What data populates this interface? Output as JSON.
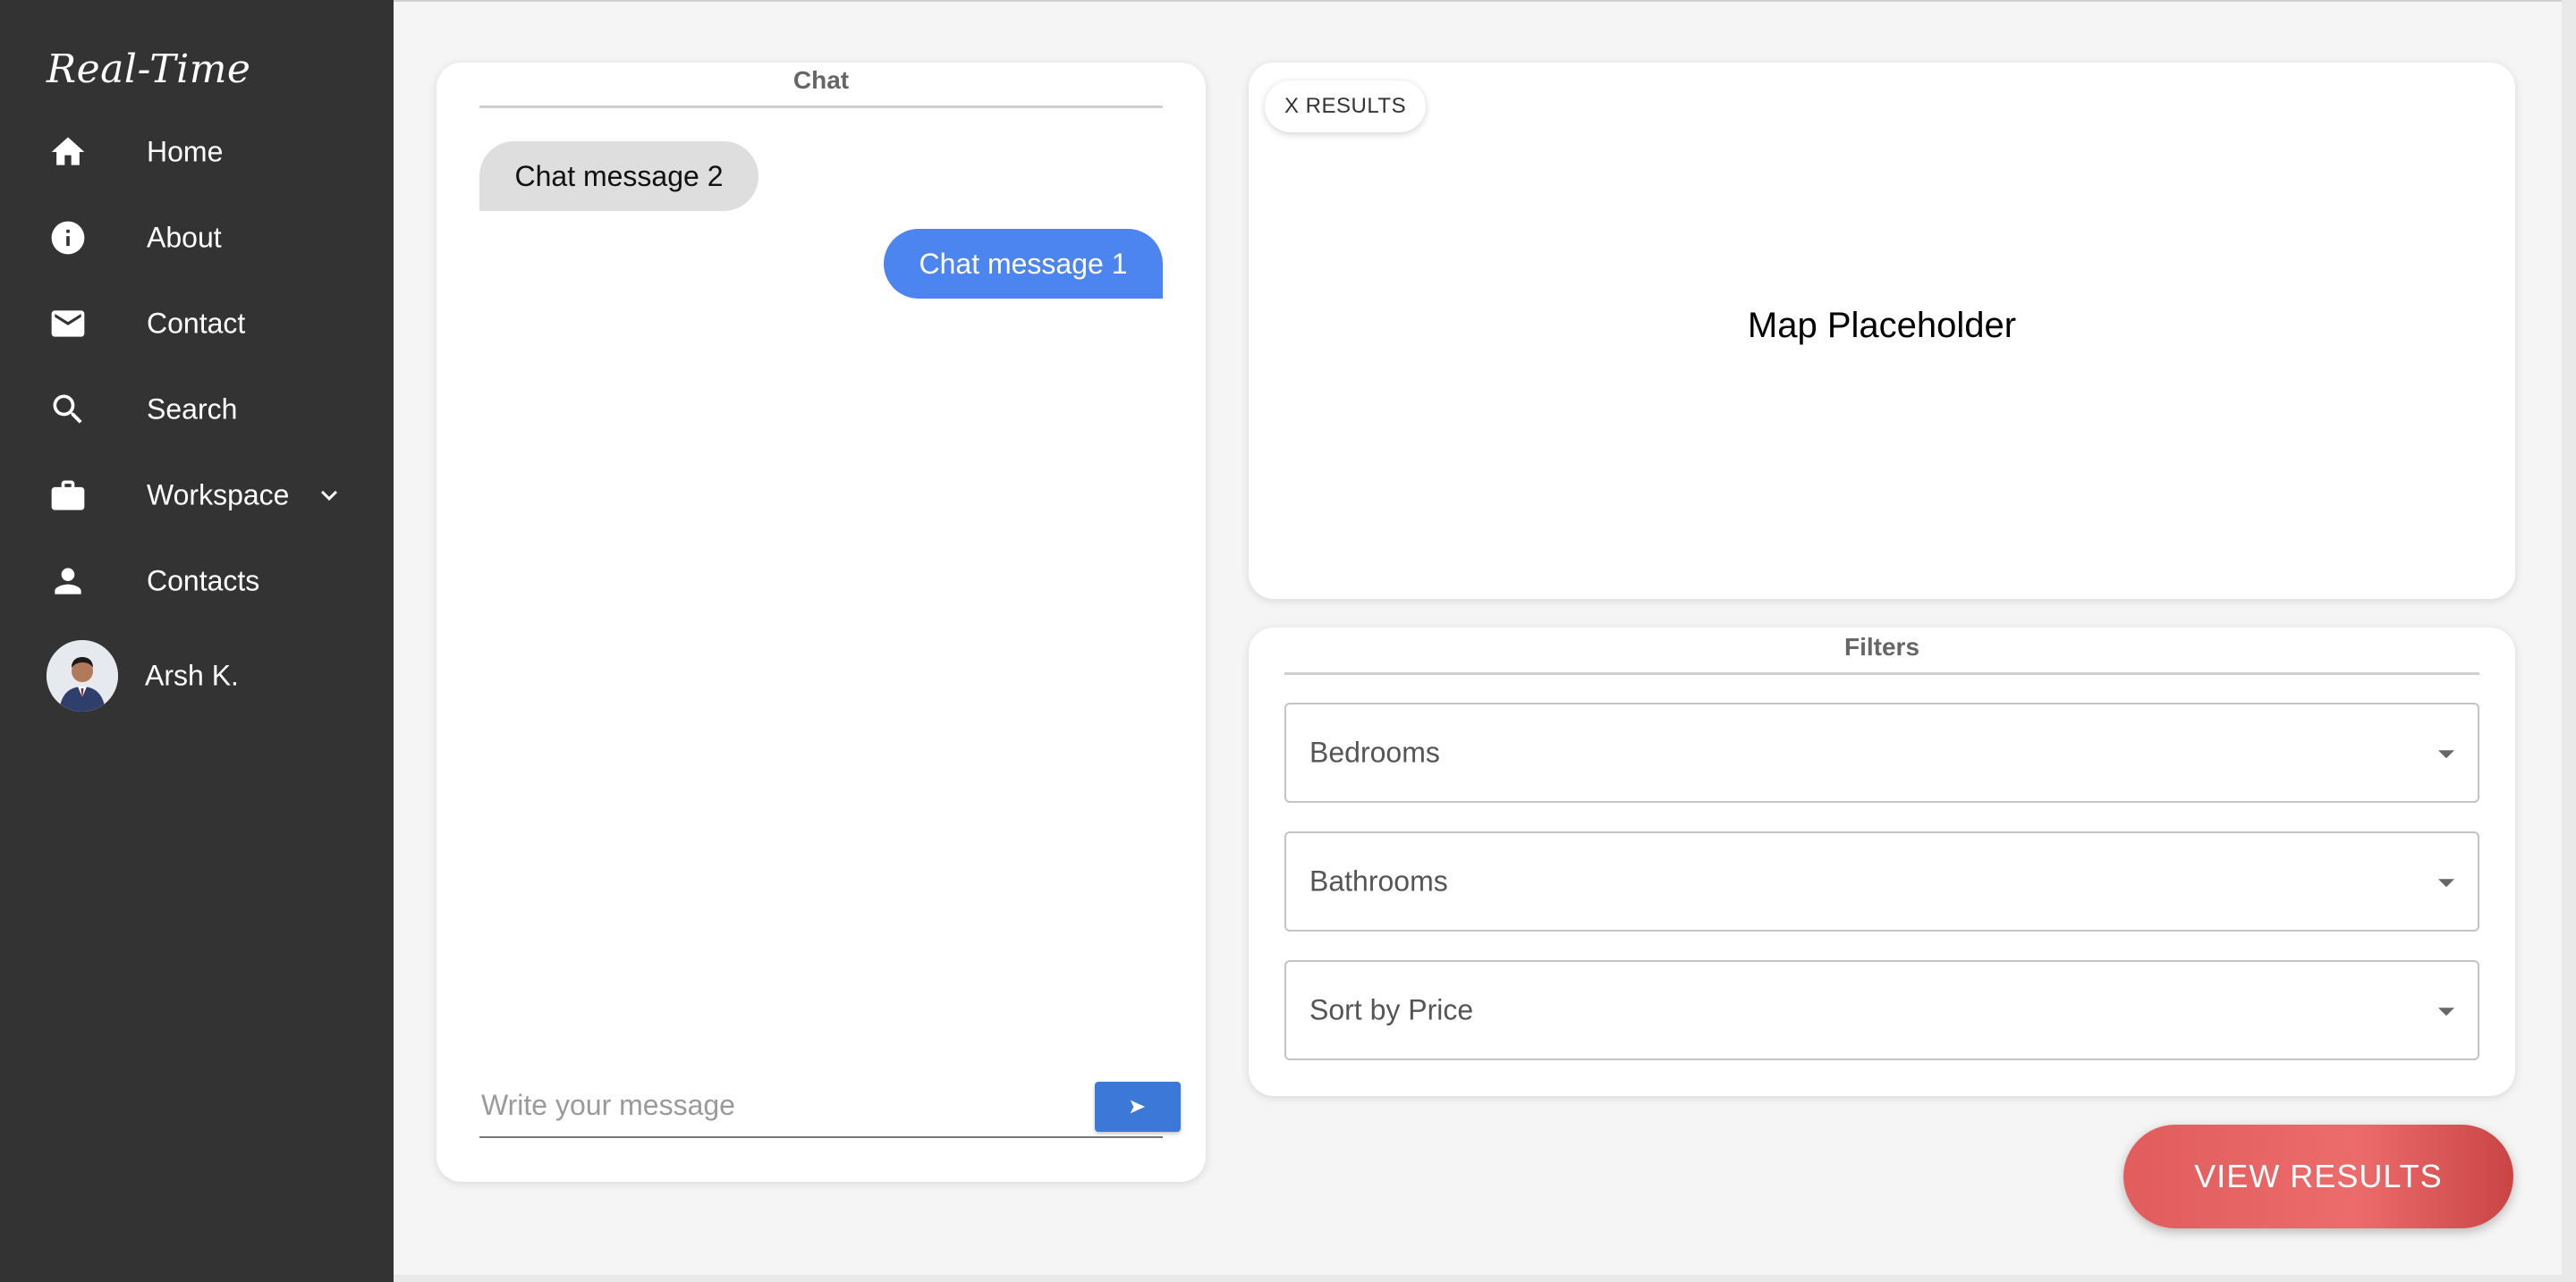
{
  "sidebar": {
    "brand": "Real-Time",
    "items": [
      {
        "label": "Home",
        "icon": "home-icon"
      },
      {
        "label": "About",
        "icon": "info-icon"
      },
      {
        "label": "Contact",
        "icon": "mail-icon"
      },
      {
        "label": "Search",
        "icon": "search-icon"
      },
      {
        "label": "Workspace",
        "icon": "briefcase-icon"
      },
      {
        "label": "Contacts",
        "icon": "person-icon"
      }
    ],
    "user": {
      "name": "Arsh K."
    }
  },
  "chat": {
    "title": "Chat",
    "messages": [
      {
        "text": "Chat message 2",
        "side": "left"
      },
      {
        "text": "Chat message 1",
        "side": "right"
      }
    ],
    "input_placeholder": "Write your message",
    "send_icon": "send-icon"
  },
  "map": {
    "results_label": "X RESULTS",
    "placeholder": "Map Placeholder"
  },
  "filters": {
    "title": "Filters",
    "selects": [
      {
        "label": "Bedrooms"
      },
      {
        "label": "Bathrooms"
      },
      {
        "label": "Sort by Price"
      }
    ]
  },
  "actions": {
    "view_results": "VIEW RESULTS"
  },
  "colors": {
    "sidebar_bg": "#333333",
    "accent_blue": "#4c84f0",
    "send_blue": "#3b78d8",
    "cta_red": "#e15d5d"
  }
}
